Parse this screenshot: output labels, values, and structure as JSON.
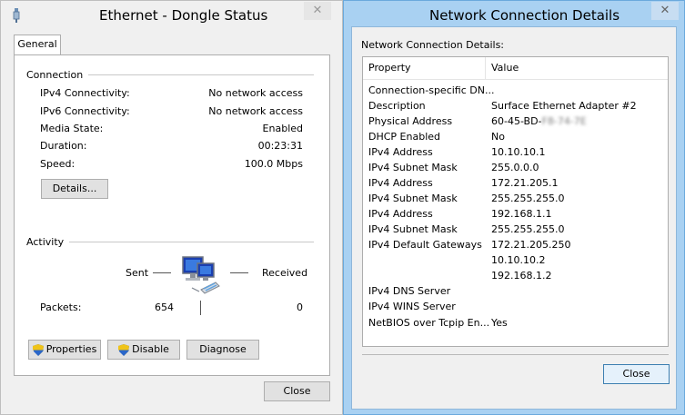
{
  "status_window": {
    "title": "Ethernet - Dongle Status",
    "tab": "General",
    "connection_group": "Connection",
    "connection": [
      {
        "label": "IPv4 Connectivity:",
        "value": "No network access"
      },
      {
        "label": "IPv6 Connectivity:",
        "value": "No network access"
      },
      {
        "label": "Media State:",
        "value": "Enabled"
      },
      {
        "label": "Duration:",
        "value": "00:23:31"
      },
      {
        "label": "Speed:",
        "value": "100.0 Mbps"
      }
    ],
    "details_button": "Details...",
    "activity_group": "Activity",
    "sent_label": "Sent",
    "received_label": "Received",
    "packets_label": "Packets:",
    "packets_sent": "654",
    "packets_received": "0",
    "buttons": {
      "properties": "Properties",
      "disable": "Disable",
      "diagnose": "Diagnose",
      "close": "Close"
    }
  },
  "details_window": {
    "title": "Network Connection Details",
    "caption": "Network Connection Details:",
    "columns": [
      "Property",
      "Value"
    ],
    "rows": [
      {
        "property": "Connection-specific DN...",
        "value": ""
      },
      {
        "property": "Description",
        "value": "Surface Ethernet Adapter #2"
      },
      {
        "property": "Physical Address",
        "value": "60-45-BD-",
        "value_blurred": "F8-74-7E"
      },
      {
        "property": "DHCP Enabled",
        "value": "No"
      },
      {
        "property": "IPv4 Address",
        "value": "10.10.10.1"
      },
      {
        "property": "IPv4 Subnet Mask",
        "value": "255.0.0.0"
      },
      {
        "property": "IPv4 Address",
        "value": "172.21.205.1"
      },
      {
        "property": "IPv4 Subnet Mask",
        "value": "255.255.255.0"
      },
      {
        "property": "IPv4 Address",
        "value": "192.168.1.1"
      },
      {
        "property": "IPv4 Subnet Mask",
        "value": "255.255.255.0"
      },
      {
        "property": "IPv4 Default Gateways",
        "value": "172.21.205.250"
      },
      {
        "property": "",
        "value": "10.10.10.2"
      },
      {
        "property": "",
        "value": "192.168.1.2"
      },
      {
        "property": "IPv4 DNS Server",
        "value": ""
      },
      {
        "property": "IPv4 WINS Server",
        "value": ""
      },
      {
        "property": "NetBIOS over Tcpip En...",
        "value": "Yes"
      }
    ],
    "close_button": "Close"
  }
}
